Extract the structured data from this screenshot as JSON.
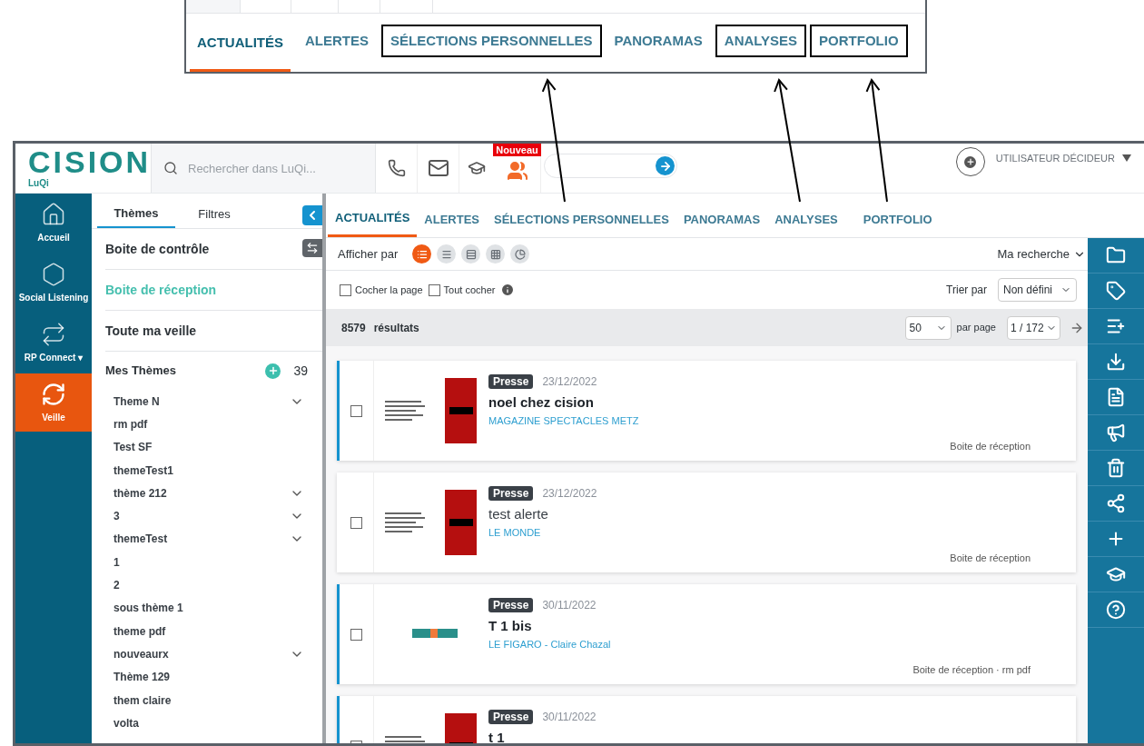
{
  "inset": {
    "tabs": [
      {
        "label": "ACTUALITÉS",
        "selected": true,
        "highlighted": false
      },
      {
        "label": "ALERTES",
        "selected": false,
        "highlighted": false
      },
      {
        "label": "SÉLECTIONS PERSONNELLES",
        "selected": false,
        "highlighted": true
      },
      {
        "label": "PANORAMAS",
        "selected": false,
        "highlighted": false
      },
      {
        "label": "ANALYSES",
        "selected": false,
        "highlighted": true
      },
      {
        "label": "PORTFOLIO",
        "selected": false,
        "highlighted": true
      }
    ]
  },
  "header": {
    "logo": "CISION",
    "logo_sub": "LuQi",
    "search": {
      "placeholder": "Rechercher dans LuQi..."
    },
    "badge": "Nouveau",
    "user": "UTILISATEUR DÉCIDEUR"
  },
  "nav": [
    {
      "label": "Accueil",
      "kind": "home",
      "selected": false
    },
    {
      "label": "Social Listening",
      "kind": "social",
      "selected": false
    },
    {
      "label": "RP Connect ▾",
      "kind": "connect",
      "selected": false
    },
    {
      "label": "Veille",
      "kind": "watch",
      "selected": true
    }
  ],
  "panel": {
    "tabs": [
      {
        "label": "Thèmes",
        "selected": true
      },
      {
        "label": "Filtres",
        "selected": false
      }
    ],
    "boxes": [
      {
        "label": "Boite de contrôle",
        "selected": false
      },
      {
        "label": "Boite de réception",
        "selected": true
      },
      {
        "label": "Toute ma veille",
        "selected": false
      }
    ],
    "my_themes": {
      "label": "Mes Thèmes",
      "count": "39"
    },
    "themes": [
      {
        "label": "Theme N",
        "collapsible": true
      },
      {
        "label": "rm pdf",
        "collapsible": false
      },
      {
        "label": "Test SF",
        "collapsible": false
      },
      {
        "label": "themeTest1",
        "collapsible": false
      },
      {
        "label": "thème 212",
        "collapsible": true
      },
      {
        "label": "3",
        "collapsible": true
      },
      {
        "label": "themeTest",
        "collapsible": true
      },
      {
        "label": "1",
        "collapsible": false
      },
      {
        "label": "2",
        "collapsible": false
      },
      {
        "label": "sous thème 1",
        "collapsible": false
      },
      {
        "label": "theme pdf",
        "collapsible": false
      },
      {
        "label": "nouveaurx",
        "collapsible": true
      },
      {
        "label": "Thème 129",
        "collapsible": false
      },
      {
        "label": "them claire",
        "collapsible": false
      },
      {
        "label": "volta",
        "collapsible": false
      }
    ]
  },
  "content": {
    "tabs": [
      {
        "label": "ACTUALITÉS",
        "selected": true
      },
      {
        "label": "ALERTES",
        "selected": false
      },
      {
        "label": "SÉLECTIONS PERSONNELLES",
        "selected": false
      },
      {
        "label": "PANORAMAS",
        "selected": false
      },
      {
        "label": "ANALYSES",
        "selected": false
      },
      {
        "label": "PORTFOLIO",
        "selected": false
      }
    ],
    "view_label": "Afficher par",
    "views": [
      {
        "kind": "list",
        "selected": true
      },
      {
        "kind": "compact",
        "selected": false
      },
      {
        "kind": "rows",
        "selected": false
      },
      {
        "kind": "grid",
        "selected": false
      },
      {
        "kind": "chart",
        "selected": false
      }
    ],
    "my_search": "Ma recherche",
    "check_page": {
      "label": "Cocher la page",
      "checked": false
    },
    "check_all": {
      "label": "Tout cocher",
      "checked": false
    },
    "sort_label": "Trier par",
    "sort_value": "Non défini",
    "count": "8579",
    "count_label": "résultats",
    "per_page": "50",
    "per_page_label": "par page",
    "page": "1 / 172",
    "articles": [
      {
        "type": "Presse",
        "date": "23/12/2022",
        "title": "noel chez cision",
        "source": "MAGAZINE SPECTACLES METZ",
        "folders": "Boite de réception",
        "checked": false,
        "unread": true,
        "kind": "press"
      },
      {
        "type": "Presse",
        "date": "23/12/2022",
        "title": "test alerte",
        "source": "LE MONDE",
        "folders": "Boite de réception",
        "checked": false,
        "unread": false,
        "kind": "press"
      },
      {
        "type": "Presse",
        "date": "30/11/2022",
        "title": "T 1 bis",
        "source": "LE FIGARO - Claire Chazal",
        "folders": "Boite de réception · rm pdf",
        "checked": false,
        "unread": true,
        "kind": "logo"
      },
      {
        "type": "Presse",
        "date": "30/11/2022",
        "title": "t 1",
        "checked": false,
        "unread": true,
        "kind": "press"
      }
    ]
  }
}
